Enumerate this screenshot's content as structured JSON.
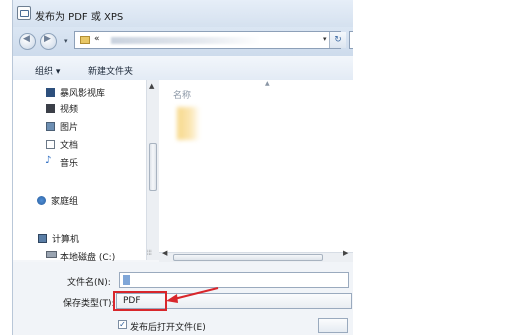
{
  "window": {
    "title": "发布为 PDF 或 XPS"
  },
  "address_bar": {
    "back_icon": "back-arrow-icon",
    "forward_icon": "forward-arrow-icon",
    "path_prefix": "«",
    "refresh_icon": "refresh-icon"
  },
  "toolbar": {
    "organize_label": "组织 ▾",
    "new_folder_label": "新建文件夹"
  },
  "sidebar": {
    "items": [
      {
        "label": "暴风影视库",
        "icon": "video-library-icon"
      },
      {
        "label": "视频",
        "icon": "video-icon"
      },
      {
        "label": "图片",
        "icon": "picture-icon"
      },
      {
        "label": "文档",
        "icon": "document-icon"
      },
      {
        "label": "音乐",
        "icon": "music-icon"
      },
      {
        "label": "家庭组",
        "icon": "homegroup-icon"
      },
      {
        "label": "计算机",
        "icon": "computer-icon"
      },
      {
        "label": "本地磁盘 (C:)",
        "icon": "drive-icon"
      }
    ]
  },
  "content": {
    "column_name": "名称"
  },
  "form": {
    "filename_label": "文件名(N):",
    "filetype_label": "保存类型(T):",
    "filetype_value": "PDF",
    "open_after_publish_label": "发布后打开文件(E)",
    "open_after_publish_checked": true
  },
  "colors": {
    "highlight_box": "#d8262b",
    "annotation_arrow": "#d8262b"
  }
}
